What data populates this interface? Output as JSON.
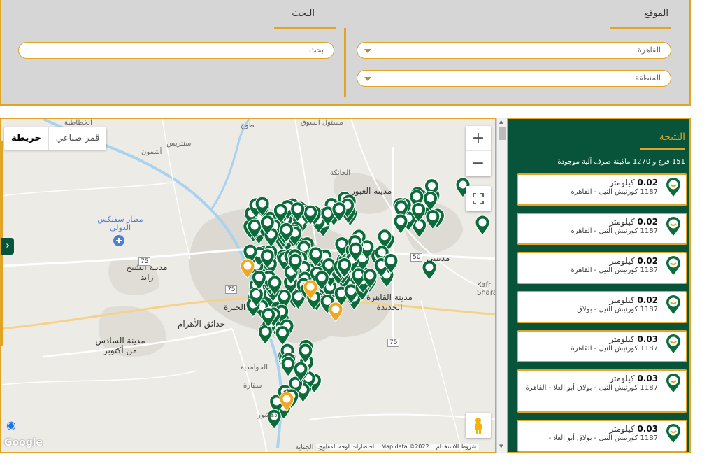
{
  "filter": {
    "location_title": "الموقع",
    "search_title": "البحث",
    "city_value": "القاهرة",
    "area_placeholder": "المنطقة",
    "search_placeholder": "بحث"
  },
  "map": {
    "type_map": "خريطة",
    "type_satellite": "قمر صناعي",
    "zoom_in": "+",
    "zoom_out": "−",
    "attribution_terms": "شروط الاستخدام",
    "attribution_data": "Map data ©2022",
    "attribution_shortcuts": "اختصارات لوحة المفاتيح",
    "google": "Google",
    "labels": {
      "airport": "مطار سفنكس الدولي",
      "zayed": "مدينة الشيخ زايد",
      "ahram": "حدائق الأهرام",
      "october": "مدينة السادس من أكتوبر",
      "obour": "مدينة العبور",
      "khanka": "الخانكة",
      "new_cairo": "مدينة القاهرة الجديدة",
      "badr": "مدينتي",
      "saqqara": "سقارة",
      "dahshur": "دهشور",
      "hawamdeya": "الحوامدية",
      "giza": "الجيزة",
      "kafr": "Kafr Shara",
      "ashmoun": "أشمون",
      "sentris": "سنتريس",
      "tukh": "طوخ",
      "souq": "مستول السوق",
      "khatatba": "الخطاطبة",
      "jenaina": "عرب الجنايه",
      "r75a": "75",
      "r75b": "75",
      "r75c": "75",
      "r50": "50"
    }
  },
  "results": {
    "title": "النتيجة",
    "summary": "151 فرع و 1270 ماكينة صرف آلية موجودة",
    "items": [
      {
        "dist": "0.02",
        "unit": "كيلومتر",
        "addr": "1187 كورنيش النيل - القاهرة"
      },
      {
        "dist": "0.02",
        "unit": "كيلومتر",
        "addr": "1187 كورنيش النيل - القاهرة"
      },
      {
        "dist": "0.02",
        "unit": "كيلومتر",
        "addr": "1187 كورنيش النيل - القاهرة"
      },
      {
        "dist": "0.02",
        "unit": "كيلومتر",
        "addr": "1187 كورنيش النيل - بولاق"
      },
      {
        "dist": "0.03",
        "unit": "كيلومتر",
        "addr": "1187 كورنيش النيل - القاهرة"
      },
      {
        "dist": "0.03",
        "unit": "كيلومتر",
        "addr": "1187 كورنيش النيل - بولاق أبو العلا - القاهرة"
      },
      {
        "dist": "0.03",
        "unit": "كيلومتر",
        "addr": "1187 كورنيش النيل - بولاق أبو العلا -"
      }
    ]
  },
  "colors": {
    "accent": "#e0a524",
    "brand_green": "#07543a",
    "pin_green": "#0b6b3a",
    "pin_orange": "#f0a823"
  }
}
